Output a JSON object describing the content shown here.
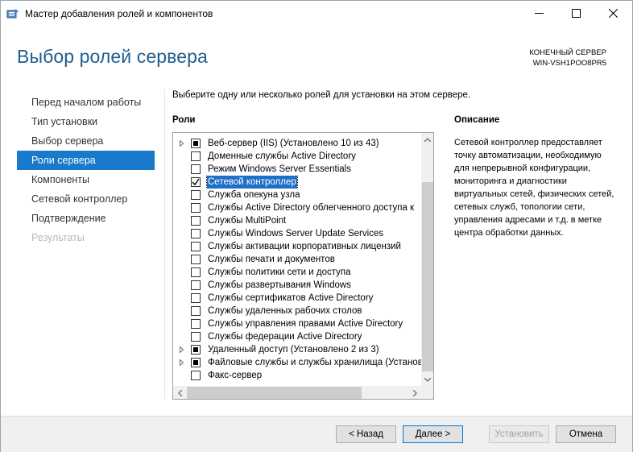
{
  "window": {
    "title": "Мастер добавления ролей и компонентов"
  },
  "header": {
    "title": "Выбор ролей сервера",
    "destination_label": "КОНЕЧНЫЙ СЕРВЕР",
    "destination_server": "WIN-VSH1POO8PR5"
  },
  "nav": {
    "items": [
      {
        "label": "Перед началом работы",
        "state": "normal"
      },
      {
        "label": "Тип установки",
        "state": "normal"
      },
      {
        "label": "Выбор сервера",
        "state": "normal"
      },
      {
        "label": "Роли сервера",
        "state": "active"
      },
      {
        "label": "Компоненты",
        "state": "normal"
      },
      {
        "label": "Сетевой контроллер",
        "state": "normal"
      },
      {
        "label": "Подтверждение",
        "state": "normal"
      },
      {
        "label": "Результаты",
        "state": "disabled"
      }
    ]
  },
  "main": {
    "instruction": "Выберите одну или несколько ролей для установки на этом сервере.",
    "roles_heading": "Роли",
    "roles": [
      {
        "label": "Веб-сервер (IIS) (Установлено 10 из 43)",
        "state": "partial",
        "expandable": true,
        "selected": false
      },
      {
        "label": "Доменные службы Active Directory",
        "state": "unchecked",
        "expandable": false,
        "selected": false
      },
      {
        "label": "Режим Windows Server Essentials",
        "state": "unchecked",
        "expandable": false,
        "selected": false
      },
      {
        "label": "Сетевой контроллер",
        "state": "checked",
        "expandable": false,
        "selected": true
      },
      {
        "label": "Служба опекуна узла",
        "state": "unchecked",
        "expandable": false,
        "selected": false
      },
      {
        "label": "Службы Active Directory облегченного доступа к",
        "state": "unchecked",
        "expandable": false,
        "selected": false
      },
      {
        "label": "Службы MultiPoint",
        "state": "unchecked",
        "expandable": false,
        "selected": false
      },
      {
        "label": "Службы Windows Server Update Services",
        "state": "unchecked",
        "expandable": false,
        "selected": false
      },
      {
        "label": "Службы активации корпоративных лицензий",
        "state": "unchecked",
        "expandable": false,
        "selected": false
      },
      {
        "label": "Службы печати и документов",
        "state": "unchecked",
        "expandable": false,
        "selected": false
      },
      {
        "label": "Службы политики сети и доступа",
        "state": "unchecked",
        "expandable": false,
        "selected": false
      },
      {
        "label": "Службы развертывания Windows",
        "state": "unchecked",
        "expandable": false,
        "selected": false
      },
      {
        "label": "Службы сертификатов Active Directory",
        "state": "unchecked",
        "expandable": false,
        "selected": false
      },
      {
        "label": "Службы удаленных рабочих столов",
        "state": "unchecked",
        "expandable": false,
        "selected": false
      },
      {
        "label": "Службы управления правами Active Directory",
        "state": "unchecked",
        "expandable": false,
        "selected": false
      },
      {
        "label": "Службы федерации Active Directory",
        "state": "unchecked",
        "expandable": false,
        "selected": false
      },
      {
        "label": "Удаленный доступ (Установлено 2 из 3)",
        "state": "partial",
        "expandable": true,
        "selected": false
      },
      {
        "label": "Файловые службы и службы хранилища (Установ",
        "state": "partial",
        "expandable": true,
        "selected": false
      },
      {
        "label": "Факс-сервер",
        "state": "unchecked",
        "expandable": false,
        "selected": false
      }
    ]
  },
  "description": {
    "heading": "Описание",
    "text": "Сетевой контроллер предоставляет точку автоматизации, необходимую для непрерывной конфигурации, мониторинга и диагностики виртуальных сетей, физических сетей, сетевых служб, топологии сети, управления адресами и т.д. в метке центра обработки данных."
  },
  "footer": {
    "back_label": "< Назад",
    "next_label": "Далее >",
    "install_label": "Установить",
    "cancel_label": "Отмена"
  },
  "icons": {
    "app": "server-manager-icon",
    "expand": "expand-arrow-icon",
    "check": "checkmark-icon"
  },
  "colors": {
    "accent": "#1979ca",
    "header_title": "#1e5d8f",
    "selection": "#1e6fc8"
  }
}
